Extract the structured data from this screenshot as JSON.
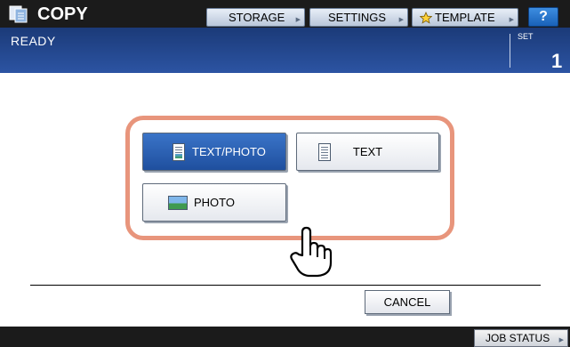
{
  "header": {
    "title": "COPY",
    "buttons": {
      "storage": "STORAGE",
      "settings": "SETTINGS",
      "template": "TEMPLATE",
      "help": "?"
    }
  },
  "status": {
    "text": "READY",
    "set_label": "SET",
    "set_count": "1"
  },
  "modes": {
    "text_photo": "TEXT/PHOTO",
    "text": "TEXT",
    "photo": "PHOTO",
    "selected": "TEXT/PHOTO"
  },
  "actions": {
    "cancel": "CANCEL"
  },
  "footer": {
    "job_status": "JOB STATUS"
  },
  "colors": {
    "header_bar": "#1b1b1b",
    "status_bar": "#2c54a3",
    "selected_button": "#2a62b8",
    "highlight_frame": "#e8957c"
  },
  "icons": [
    "copy-icon",
    "arrow-icon",
    "star-icon",
    "document-icon",
    "photo-icon",
    "pointing-hand-icon"
  ]
}
